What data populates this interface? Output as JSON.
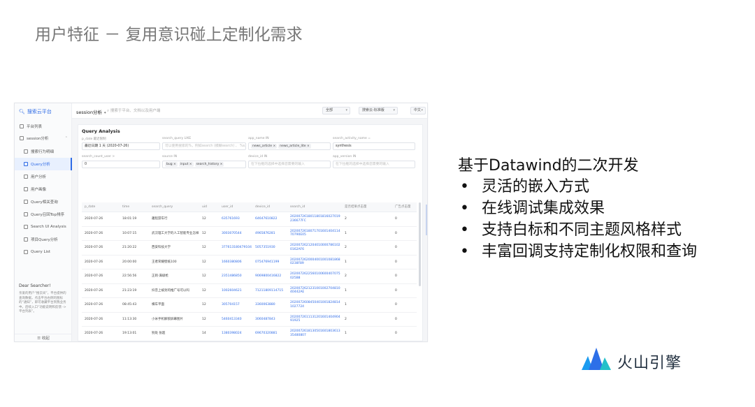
{
  "slide": {
    "title": "用户特征 － 复用意识碰上定制化需求",
    "heading": "基于Datawind的二次开发",
    "bullets": [
      "灵活的嵌入方式",
      "在线调试集成效果",
      "支持白标和不同主题风格样式",
      "丰富回调支持定制化权限和查询"
    ],
    "bullet_symbol": "•"
  },
  "brand": {
    "name": "火山引擎",
    "logo_colors": [
      "#1c9bf0",
      "#2d6fe8",
      "#23c0c9"
    ]
  },
  "screenshot": {
    "sidebar": {
      "logo": "搜索云平台",
      "items": [
        {
          "label": "平台列表",
          "sub": false,
          "active": false,
          "caret": ""
        },
        {
          "label": "session分析",
          "sub": false,
          "active": false,
          "caret": "⌃"
        },
        {
          "label": "搜索行为明细",
          "sub": true,
          "active": false,
          "caret": ""
        },
        {
          "label": "Query分析",
          "sub": true,
          "active": true,
          "caret": ""
        },
        {
          "label": "用户分析",
          "sub": true,
          "active": false,
          "caret": ""
        },
        {
          "label": "用户画像",
          "sub": true,
          "active": false,
          "caret": ""
        },
        {
          "label": "Query相关查询",
          "sub": true,
          "active": false,
          "caret": ""
        },
        {
          "label": "Query召回Top排序",
          "sub": true,
          "active": false,
          "caret": ""
        },
        {
          "label": "Search UI Analysis",
          "sub": true,
          "active": false,
          "caret": ""
        },
        {
          "label": "项目Query分析",
          "sub": true,
          "active": false,
          "caret": ""
        },
        {
          "label": "Query List",
          "sub": true,
          "active": false,
          "caret": ""
        }
      ],
      "note_title": "Dear Searcher!",
      "note_body": "亲爱的用户“搜云间”，平台提供的查询数据，点击平台右侧的图标的“通知”，即可收藏平台到我业务中。后续入口“功能说明和反馈 -> 平台列表”。",
      "footer": "☰ 收起"
    },
    "topbar": {
      "title": "session分析",
      "search_placeholder": "搜索于平台、文档以及用户端",
      "selects": [
        "全部",
        "搜索云-标准版",
        "中文"
      ]
    },
    "panel": {
      "title": "Query Analysis",
      "fields": [
        {
          "label": "p_date 最近限制",
          "value": "最近日期 1 天 (2020-07-26)",
          "placeholder": false
        },
        {
          "label": "search_query LIKE",
          "value": "可以使用搜索的%，例如search (模糊search) 、 %s...",
          "placeholder": true
        },
        {
          "label": "app_name IN",
          "value": "",
          "chips": [
            "news_article ×",
            "news_article_lite ×"
          ],
          "placeholder": false
        },
        {
          "label": "search_activity_name =",
          "value": "synthesis",
          "placeholder": false
        },
        {
          "label": "search_count_user >",
          "value": "0",
          "placeholder": false
        },
        {
          "label": "source IN",
          "value": "",
          "chips": [
            "bug ×",
            "input ×",
            "search_history ×"
          ],
          "placeholder": false
        },
        {
          "label": "device_id IN",
          "value": "在下拉框的选择中选择您需要的输入",
          "placeholder": true
        },
        {
          "label": "app_version IN",
          "value": "在下拉框的选择中选择您需要的输入",
          "placeholder": true
        }
      ]
    },
    "table": {
      "columns": [
        "p_date",
        "time",
        "search_query",
        "uid",
        "user_id",
        "device_id",
        "search_id",
        "是否结果点击量",
        "广告点击量"
      ],
      "rows": [
        [
          "2020-07-26",
          "18:01:19",
          "趣程游车行",
          "12",
          "635761693",
          "64647610822",
          "2020072618011801816027019236677FC",
          "2",
          "0"
        ],
        [
          "2020-07-26",
          "10:07:15",
          "武汉理工大学的人工智能专业怎样",
          "12",
          "3003070544",
          "4965876281",
          "202007261807170160140411470790E05",
          "1",
          "0"
        ],
        [
          "2020-07-26",
          "21:20:22",
          "西安科技大学",
          "12",
          "377613180479104",
          "5057351930",
          "20200726212040100007861020162AF6",
          "2",
          "0"
        ],
        [
          "2020-07-26",
          "20:00:00",
          "王者荣耀壁纸100",
          "12",
          "1660380806",
          "075476941199",
          "20200726200040010010818680238F89",
          "1",
          "0"
        ],
        [
          "2020-07-26",
          "22:56:56",
          "正则·满级枪",
          "12",
          "2351486850",
          "9069800416822",
          "2020072622560100600407075025B8",
          "2",
          "0"
        ],
        [
          "2020-07-26",
          "21:23:19",
          "抖音上被封的推广号可以吗",
          "12",
          "1002604621",
          "71211809114715",
          "202007262123100100270481040442AE",
          "1",
          "0"
        ],
        [
          "2020-07-26",
          "08:45:43",
          "横车平面",
          "12",
          "305704157",
          "3360063880",
          "20200726084504010018248141027724",
          "1",
          "0"
        ],
        [
          "2020-07-26",
          "11:13:30",
          "小米手机解锁屏幕图片",
          "12",
          "5460413340",
          "3060487843",
          "202007261113120160140490491925",
          "2",
          "0"
        ],
        [
          "2020-07-26",
          "19:13:01",
          "别处 张超",
          "14",
          "1380398024",
          "69670320881",
          "202007261813050160180361335480807",
          "1",
          "0"
        ],
        [
          "2020-07-26",
          "08:56:50",
          "faed·桶子裙子",
          "12",
          "34713968610042",
          "73649489782",
          "20200726085600010018023044348F78D",
          "4",
          "0"
        ],
        [
          "2020-07-26",
          "09:19:24",
          "的方文人员多分析",
          "12",
          "3457063900",
          "2325862320",
          "202007260919001010123107",
          "1",
          "0"
        ]
      ]
    }
  }
}
